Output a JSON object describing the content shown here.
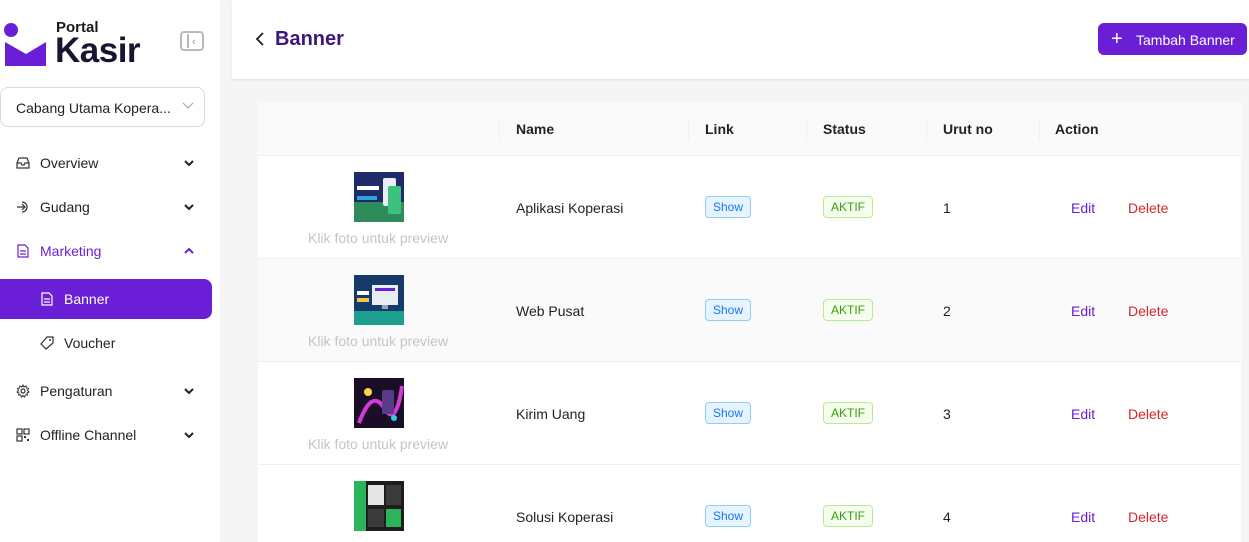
{
  "brand": {
    "small": "Portal",
    "big": "Kasir",
    "color": "#6a1fd6"
  },
  "sidebar": {
    "branch_select": "Cabang Utama Kopera...",
    "items": [
      {
        "label": "Overview",
        "icon": "inbox-icon"
      },
      {
        "label": "Gudang",
        "icon": "login-icon"
      },
      {
        "label": "Marketing",
        "icon": "file-icon",
        "open": true
      },
      {
        "label": "Pengaturan",
        "icon": "gear-icon"
      },
      {
        "label": "Offline Channel",
        "icon": "qrcode-icon"
      }
    ],
    "sub_items": [
      {
        "label": "Banner",
        "icon": "file-icon",
        "active": true
      },
      {
        "label": "Voucher",
        "icon": "tag-icon"
      }
    ]
  },
  "header": {
    "title": "Banner",
    "add_button": "Tambah Banner"
  },
  "table": {
    "columns": [
      "",
      "Name",
      "Link",
      "Status",
      "Urut no",
      "Action"
    ],
    "preview_hint": "Klik foto untuk preview",
    "rows": [
      {
        "name": "Aplikasi Koperasi",
        "link": "Show",
        "status": "AKTIF",
        "order": "1",
        "edit": "Edit",
        "delete": "Delete"
      },
      {
        "name": "Web Pusat",
        "link": "Show",
        "status": "AKTIF",
        "order": "2",
        "edit": "Edit",
        "delete": "Delete"
      },
      {
        "name": "Kirim Uang",
        "link": "Show",
        "status": "AKTIF",
        "order": "3",
        "edit": "Edit",
        "delete": "Delete"
      },
      {
        "name": "Solusi Koperasi",
        "link": "Show",
        "status": "AKTIF",
        "order": "4",
        "edit": "Edit",
        "delete": "Delete"
      }
    ]
  }
}
